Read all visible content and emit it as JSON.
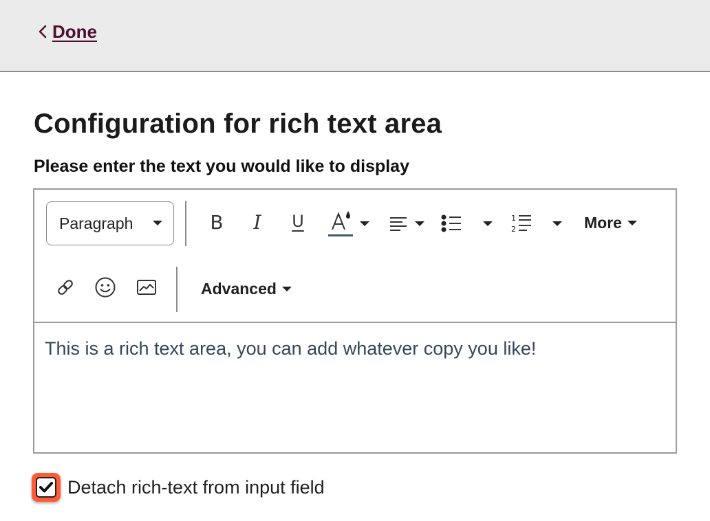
{
  "header": {
    "back_label": "Done"
  },
  "page": {
    "title": "Configuration for rich text area",
    "field_label": "Please enter the text you would like to display"
  },
  "toolbar": {
    "block_format": "Paragraph",
    "bold_glyph": "B",
    "italic_glyph": "I",
    "underline_glyph": "U",
    "more_label": "More",
    "advanced_label": "Advanced",
    "text_color_underline": "#3d5a70"
  },
  "editor": {
    "content": "This is a rich text area, you can add whatever copy you like!"
  },
  "options": {
    "detach_label": "Detach rich-text from input field",
    "detach_checked": true,
    "accent_color": "#ff5c35"
  },
  "icons": [
    "chevron-left-icon",
    "text-color-icon",
    "align-left-icon",
    "bulleted-list-icon",
    "numbered-list-icon",
    "link-icon",
    "emoji-icon",
    "image-icon",
    "checkmark-icon"
  ]
}
